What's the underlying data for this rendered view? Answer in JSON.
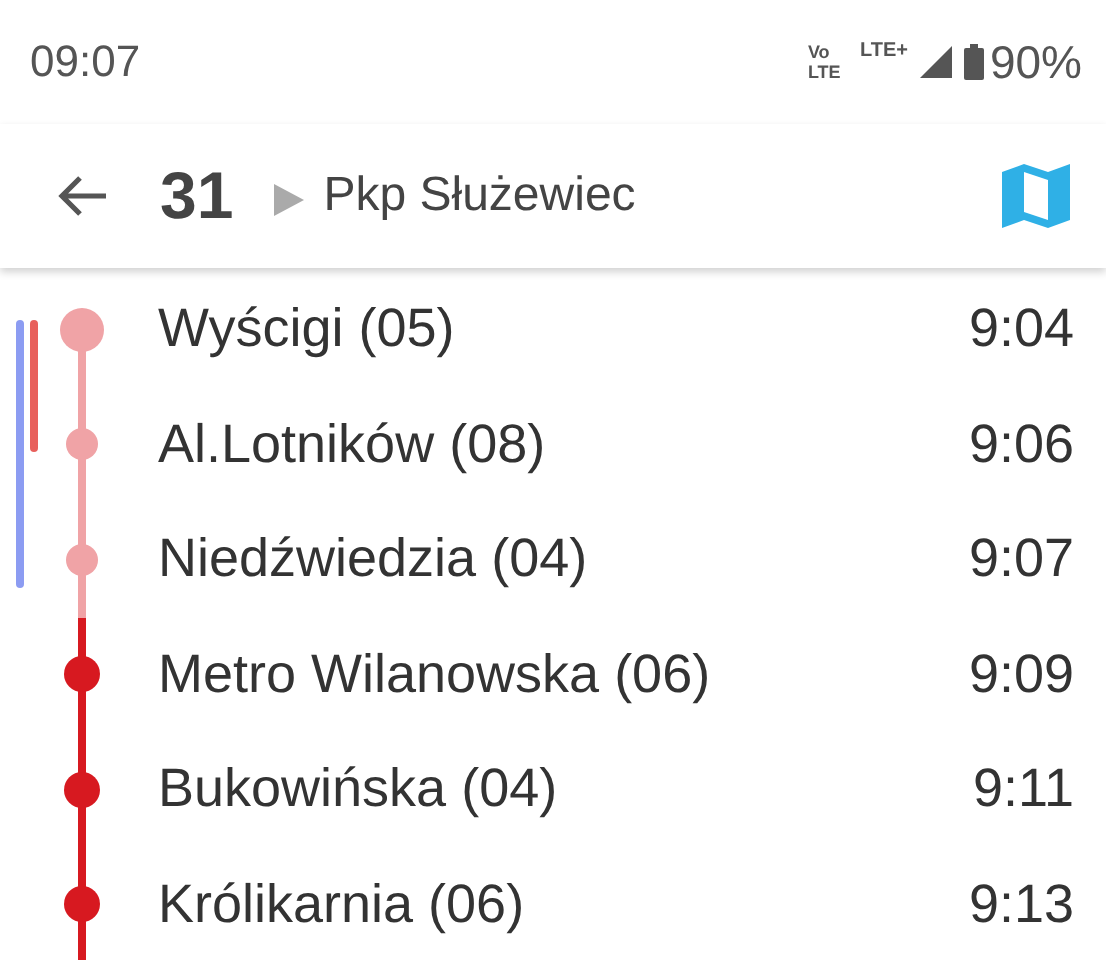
{
  "status_bar": {
    "time": "09:07",
    "volte": "Vo LTE",
    "network": "LTE+",
    "battery": "90%"
  },
  "header": {
    "line": "31",
    "direction": "Pkp Służewiec"
  },
  "vehicle_markers": [
    {
      "color": "#8c9cf2"
    },
    {
      "color": "#e8605c"
    }
  ],
  "stops": [
    {
      "name": "Wyścigi (05)",
      "time": "9:04",
      "passed": true,
      "current": true
    },
    {
      "name": "Al.Lotników (08)",
      "time": "9:06",
      "passed": true,
      "current": false
    },
    {
      "name": "Niedźwiedzia (04)",
      "time": "9:07",
      "passed": true,
      "current": false
    },
    {
      "name": "Metro Wilanowska (06)",
      "time": "9:09",
      "passed": false,
      "current": false
    },
    {
      "name": "Bukowińska (04)",
      "time": "9:11",
      "passed": false,
      "current": false
    },
    {
      "name": "Królikarnia (06)",
      "time": "9:13",
      "passed": false,
      "current": false
    }
  ]
}
